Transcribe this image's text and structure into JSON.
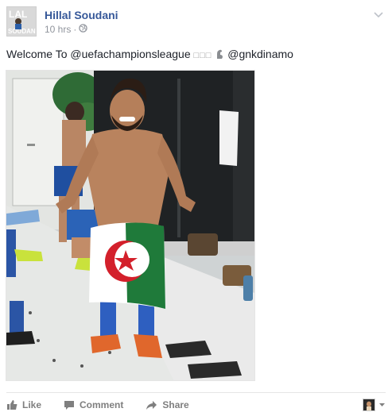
{
  "post": {
    "author": "Hillal Soudani",
    "time": "10 hrs",
    "separator": "·",
    "privacy_icon": "globe-icon",
    "text_prefix": "Welcome To",
    "mention_1": "@uefachampionsleague",
    "unrendered_glyphs": "□□□",
    "emoji_icon": "flexed-bicep-emoji-icon",
    "mention_2": "@gnkdinamo",
    "avatar_lettering": "LAL SOUDANI"
  },
  "actions": {
    "like": "Like",
    "comment": "Comment",
    "share": "Share"
  },
  "colors": {
    "author_link": "#365899",
    "meta_gray": "#90949c",
    "action_gray": "#7f7f7f",
    "divider": "#e5e5e5"
  }
}
